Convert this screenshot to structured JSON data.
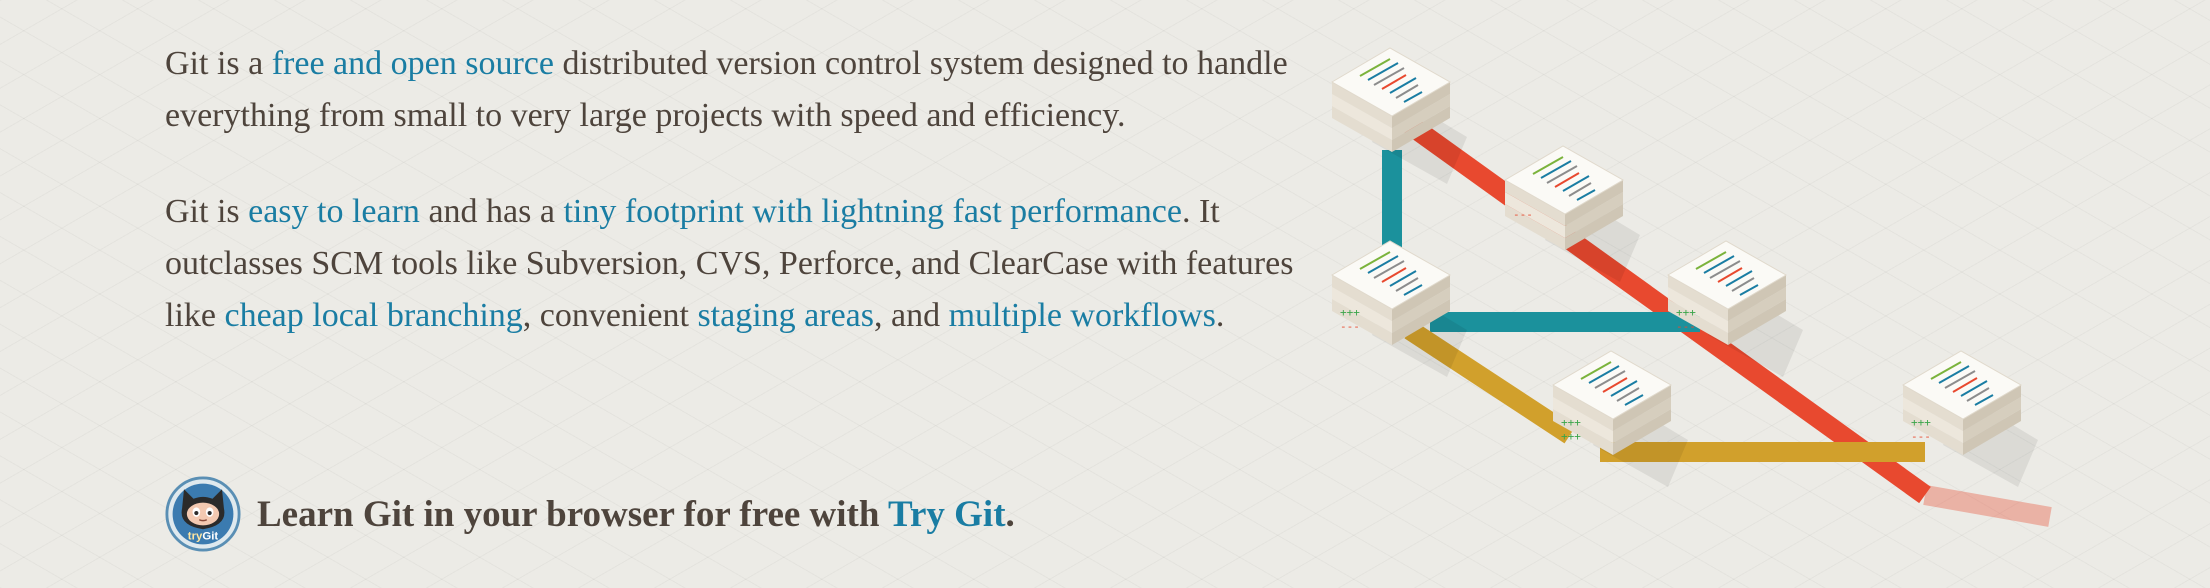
{
  "intro": {
    "p1": {
      "t1": "Git is a ",
      "link_free": "free and open source",
      "t2": " distributed version control system designed to handle everything from small to very large projects with speed and efficiency."
    },
    "p2": {
      "t1": "Git is ",
      "link_easy": "easy to learn",
      "t2": " and has a ",
      "link_footprint": "tiny footprint with lightning fast performance",
      "t3": ". It outclasses SCM tools like Subversion, CVS, Perforce, and ClearCase with features like ",
      "link_branching": "cheap local branching",
      "t4": ", convenient ",
      "link_staging": "staging areas",
      "t5": ", and ",
      "link_workflows": "multiple workflows",
      "t6": "."
    }
  },
  "try_git": {
    "lead": "Learn Git in your browser for free with ",
    "link": "Try Git",
    "end": ".",
    "badge_label_try": "try",
    "badge_label_git": "Git"
  },
  "colors": {
    "link": "#1a7da3",
    "text": "#4e443c",
    "branch_red": "#e8492f",
    "branch_teal": "#1b919c",
    "branch_yellow": "#d1a02c",
    "background": "#ecebe6"
  },
  "icons": {
    "badge": "octocat-trygit-icon",
    "illustration": "branching-diagram"
  }
}
